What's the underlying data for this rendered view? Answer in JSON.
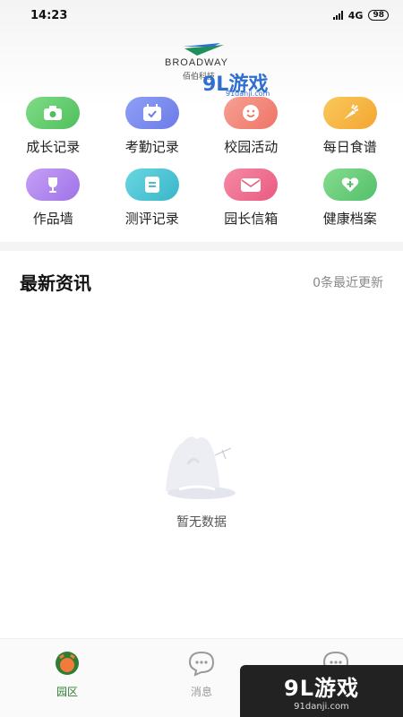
{
  "status_bar": {
    "time": "14:23",
    "network": "4G",
    "battery": "98"
  },
  "brand": {
    "logo_text": "BROADWAY",
    "logo_sub": "佰伯科技"
  },
  "watermark_top": {
    "main": "9L游戏",
    "sub": "91danji.com"
  },
  "features": [
    {
      "label": "成长记录",
      "icon": "camera-icon",
      "color": "#6ccf74"
    },
    {
      "label": "考勤记录",
      "icon": "calendar-check-icon",
      "color": "#7f8ff0"
    },
    {
      "label": "校园活动",
      "icon": "smile-icon",
      "color": "#f08a7f"
    },
    {
      "label": "每日食谱",
      "icon": "carrot-icon",
      "color": "#f7b640"
    },
    {
      "label": "作品墙",
      "icon": "trophy-icon",
      "color": "#b48af0"
    },
    {
      "label": "测评记录",
      "icon": "document-icon",
      "color": "#4fc7d6"
    },
    {
      "label": "园长信箱",
      "icon": "mail-icon",
      "color": "#f06e8e"
    },
    {
      "label": "健康档案",
      "icon": "health-icon",
      "color": "#6ccf84"
    }
  ],
  "news": {
    "title": "最新资讯",
    "count_text": "0条最近更新",
    "empty_text": "暂无数据"
  },
  "tabs": [
    {
      "label": "园区",
      "icon": "campus-icon",
      "active": true
    },
    {
      "label": "消息",
      "icon": "message-icon",
      "active": false
    },
    {
      "label": "",
      "icon": "chat-icon",
      "active": false
    }
  ],
  "watermark": {
    "main": "9L游戏",
    "sub": "91danji.com"
  }
}
